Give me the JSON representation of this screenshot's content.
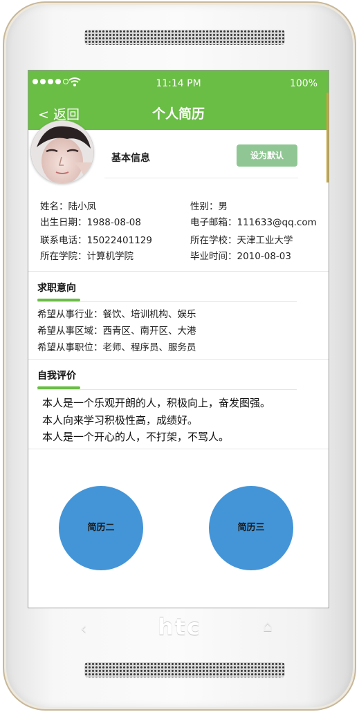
{
  "device": {
    "brand_logo": "htc",
    "back_key_icon": "‹",
    "home_key_icon": "⌂"
  },
  "status_bar": {
    "signal_dots": 5,
    "time": "11:14 PM",
    "battery": "100%"
  },
  "nav": {
    "back_label": "< 返回",
    "title": "个人简历"
  },
  "basic": {
    "section_title": "基本信息",
    "default_button": "设为默认"
  },
  "info": {
    "name": "姓名：陆小凤",
    "gender": "性别：男",
    "birthday": "出生日期：1988-08-08",
    "email": "电子邮箱：111633@qq.com",
    "phone": "联系电话：15022401129",
    "school": "所在学校：天津工业大学",
    "college": "所在学院：计算机学院",
    "graduation": "毕业时间：2010-08-03"
  },
  "intention": {
    "title": "求职意向",
    "industry": "希望从事行业：餐饮、培训机构、娱乐",
    "region": "希望从事区域：西青区、南开区、大港",
    "position": "希望从事职位：老师、程序员、服务员"
  },
  "evaluation": {
    "title": "自我评价",
    "lines": [
      "本人是一个乐观开朗的人，积极向上，奋发图强。",
      "本人向来学习积极性高，成绩好。",
      "本人是一个开心的人，不打架，不骂人。"
    ]
  },
  "actions": {
    "resume_two": "简历二",
    "resume_three": "简历三"
  },
  "colors": {
    "green": "#6abd45",
    "button_green": "#8fc693",
    "circle_blue": "#4395d8"
  }
}
